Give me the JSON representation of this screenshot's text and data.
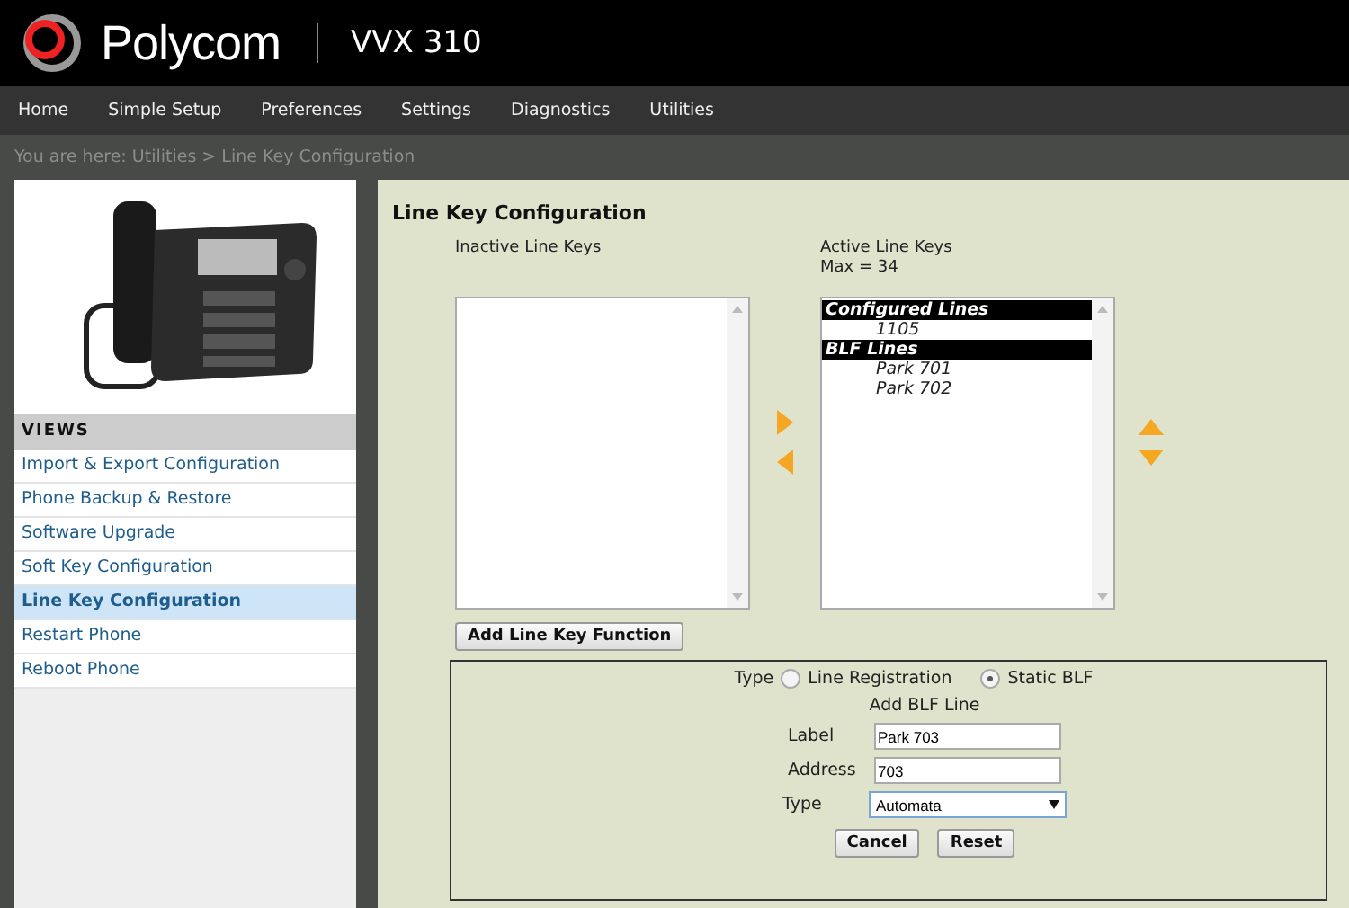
{
  "header": {
    "brand": "Polycom",
    "model": "VVX 310"
  },
  "nav": [
    "Home",
    "Simple Setup",
    "Preferences",
    "Settings",
    "Diagnostics",
    "Utilities"
  ],
  "breadcrumb": "You are here: Utilities > Line Key Configuration",
  "sidebar": {
    "heading": "VIEWS",
    "items": [
      {
        "label": "Import & Export Configuration",
        "selected": false
      },
      {
        "label": "Phone Backup & Restore",
        "selected": false
      },
      {
        "label": "Software Upgrade",
        "selected": false
      },
      {
        "label": "Soft Key Configuration",
        "selected": false
      },
      {
        "label": "Line Key Configuration",
        "selected": true
      },
      {
        "label": "Restart Phone",
        "selected": false
      },
      {
        "label": "Reboot Phone",
        "selected": false
      }
    ]
  },
  "main": {
    "title": "Line Key Configuration",
    "inactive": {
      "label": "Inactive Line Keys"
    },
    "active": {
      "label": "Active Line Keys",
      "max": "Max = 34",
      "entries": [
        {
          "kind": "group",
          "text": "Configured Lines"
        },
        {
          "kind": "item",
          "text": "1105"
        },
        {
          "kind": "group",
          "text": "BLF Lines"
        },
        {
          "kind": "item",
          "text": "Park 701"
        },
        {
          "kind": "item",
          "text": "Park 702"
        }
      ]
    },
    "add_button": "Add Line Key Function",
    "form": {
      "type_label": "Type",
      "types": [
        {
          "label": "Line Registration",
          "selected": false
        },
        {
          "label": "Static BLF",
          "selected": true
        }
      ],
      "subtitle": "Add BLF Line",
      "fields": [
        {
          "label": "Label",
          "value": "Park 703"
        },
        {
          "label": "Address",
          "value": "703"
        }
      ],
      "select": {
        "label": "Type",
        "value": "Automata"
      },
      "buttons": [
        "Cancel",
        "Reset"
      ]
    }
  }
}
